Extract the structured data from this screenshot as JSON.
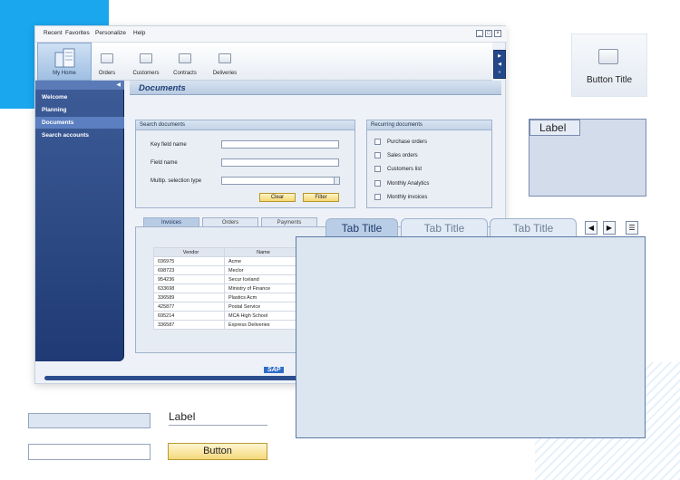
{
  "colors": {
    "accent": "#1aa7ee",
    "sidebar": "#2b4a86",
    "selected_nav": "#5b7fc0",
    "button_yellow": "#f3d874",
    "panel_bg": "#e9eef5"
  },
  "menubar": {
    "items": [
      "Recent",
      "Favorites",
      "Personalize",
      "Help"
    ]
  },
  "toolbar": {
    "home_label": "My Home",
    "items": [
      "Orders",
      "Customers",
      "Contracts",
      "Deliveries"
    ]
  },
  "sidebar": {
    "items": [
      "Welcome",
      "Planning",
      "Documents",
      "Search accounts"
    ],
    "selected": "Documents"
  },
  "page": {
    "title": "Documents"
  },
  "search": {
    "title": "Search documents",
    "fields": [
      {
        "label": "Key field name",
        "value": ""
      },
      {
        "label": "Field name",
        "value": ""
      },
      {
        "label": "Multip. selection type",
        "value": ""
      }
    ],
    "clear_label": "Clear",
    "filter_label": "Filter"
  },
  "recurring": {
    "title": "Recurring documents",
    "items": [
      "Purchase orders",
      "Sales orders",
      "Customers list",
      "Monthly Analytics",
      "Monthly invoices"
    ]
  },
  "tabs": {
    "items": [
      "Invoices",
      "Orders",
      "Payments"
    ],
    "selected": "Invoices"
  },
  "invoice_table": {
    "headers": [
      "Vendor",
      "Name"
    ],
    "rows": [
      [
        "036975",
        "Acme"
      ],
      [
        "698723",
        "Meclor"
      ],
      [
        "954236",
        "Secur Iceland"
      ],
      [
        "633698",
        "Ministry of Finance"
      ],
      [
        "336589",
        "Plastics Acm"
      ],
      [
        "425877",
        "Postal Service"
      ],
      [
        "695214",
        "MCA High School"
      ],
      [
        "336587",
        "Express Deliveries"
      ]
    ]
  },
  "footer": {
    "logo": "SAP"
  },
  "overlay": {
    "tabs": [
      "Tab Title",
      "Tab Title",
      "Tab Title"
    ],
    "selected_index": 0
  },
  "widgets": {
    "button_title": "Button Title",
    "group_label": "Label",
    "field_label": "Label",
    "button_label": "Button"
  }
}
